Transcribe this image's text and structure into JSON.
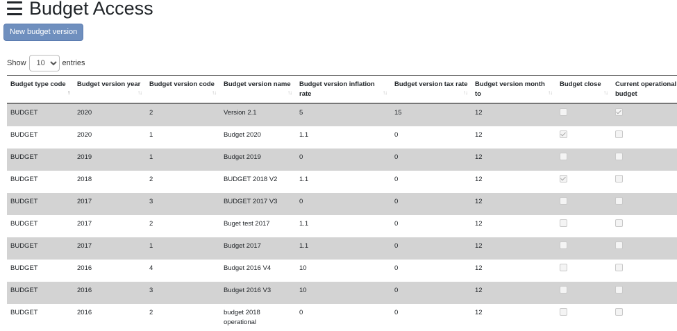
{
  "header": {
    "title": "Budget Access",
    "menu_icon": "hamburger-menu-icon"
  },
  "toolbar": {
    "new_label": "New budget version"
  },
  "length": {
    "show_label": "Show",
    "value": "10",
    "entries_label": "entries"
  },
  "table": {
    "columns": [
      "Budget type code",
      "Budget version year",
      "Budget version code",
      "Budget version name",
      "Budget version inflation rate",
      "Budget version tax rate",
      "Budget version month to",
      "Budget close",
      "Current operational budget"
    ],
    "rows": [
      {
        "type": "BUDGET",
        "year": "2020",
        "code": "2",
        "name": "Version 2.1",
        "inflation": "5",
        "tax": "15",
        "month": "12",
        "close": false,
        "current": true
      },
      {
        "type": "BUDGET",
        "year": "2020",
        "code": "1",
        "name": "Budget 2020",
        "inflation": "1.1",
        "tax": "0",
        "month": "12",
        "close": true,
        "current": false
      },
      {
        "type": "BUDGET",
        "year": "2019",
        "code": "1",
        "name": "Budget 2019",
        "inflation": "0",
        "tax": "0",
        "month": "12",
        "close": false,
        "current": false
      },
      {
        "type": "BUDGET",
        "year": "2018",
        "code": "2",
        "name": "BUDGET 2018 V2",
        "inflation": "1.1",
        "tax": "0",
        "month": "12",
        "close": true,
        "current": false
      },
      {
        "type": "BUDGET",
        "year": "2017",
        "code": "3",
        "name": "BUDGET 2017 V3",
        "inflation": "0",
        "tax": "0",
        "month": "12",
        "close": false,
        "current": false
      },
      {
        "type": "BUDGET",
        "year": "2017",
        "code": "2",
        "name": "Buget test 2017",
        "inflation": "1.1",
        "tax": "0",
        "month": "12",
        "close": false,
        "current": false
      },
      {
        "type": "BUDGET",
        "year": "2017",
        "code": "1",
        "name": "Budget 2017",
        "inflation": "1.1",
        "tax": "0",
        "month": "12",
        "close": false,
        "current": false
      },
      {
        "type": "BUDGET",
        "year": "2016",
        "code": "4",
        "name": "Budget 2016 V4",
        "inflation": "10",
        "tax": "0",
        "month": "12",
        "close": false,
        "current": false
      },
      {
        "type": "BUDGET",
        "year": "2016",
        "code": "3",
        "name": "Budget 2016 V3",
        "inflation": "10",
        "tax": "0",
        "month": "12",
        "close": false,
        "current": false
      },
      {
        "type": "BUDGET",
        "year": "2016",
        "code": "2",
        "name": "budget 2018 operational",
        "inflation": "0",
        "tax": "0",
        "month": "12",
        "close": false,
        "current": false
      }
    ]
  }
}
